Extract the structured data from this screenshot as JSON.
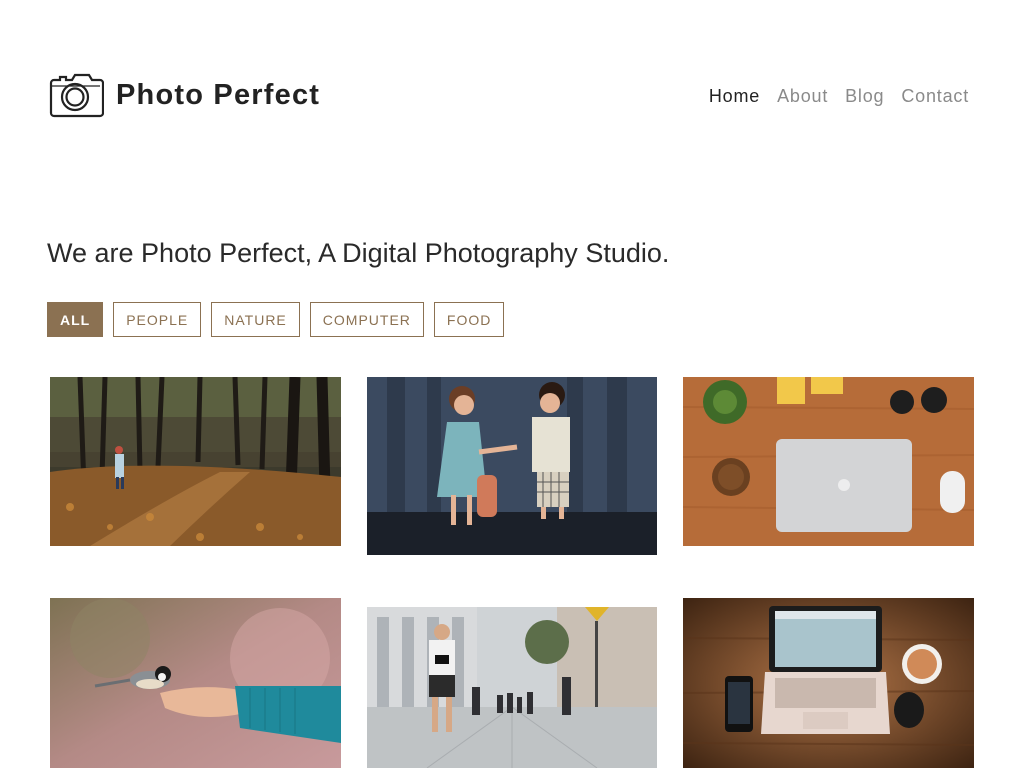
{
  "brand": {
    "title": "Photo Perfect",
    "icon": "camera-icon"
  },
  "nav": {
    "items": [
      {
        "label": "Home",
        "active": true
      },
      {
        "label": "About",
        "active": false
      },
      {
        "label": "Blog",
        "active": false
      },
      {
        "label": "Contact",
        "active": false
      }
    ]
  },
  "intro": {
    "text": "We are Photo Perfect, A Digital Photography Studio."
  },
  "filters": {
    "items": [
      {
        "label": "ALL",
        "active": true
      },
      {
        "label": "PEOPLE",
        "active": false
      },
      {
        "label": "NATURE",
        "active": false
      },
      {
        "label": "COMPUTER",
        "active": false
      },
      {
        "label": "FOOD",
        "active": false
      }
    ]
  },
  "colors": {
    "accent": "#8b7152",
    "text": "#222222",
    "nav_inactive": "#8a8a8a"
  },
  "gallery": {
    "photos": [
      {
        "subject": "autumn forest path with child"
      },
      {
        "subject": "two children holding hands"
      },
      {
        "subject": "laptop on wooden desk top view"
      },
      {
        "subject": "bird feeding from hand"
      },
      {
        "subject": "photographer on city street"
      },
      {
        "subject": "laptop and phone on wooden table"
      }
    ]
  }
}
